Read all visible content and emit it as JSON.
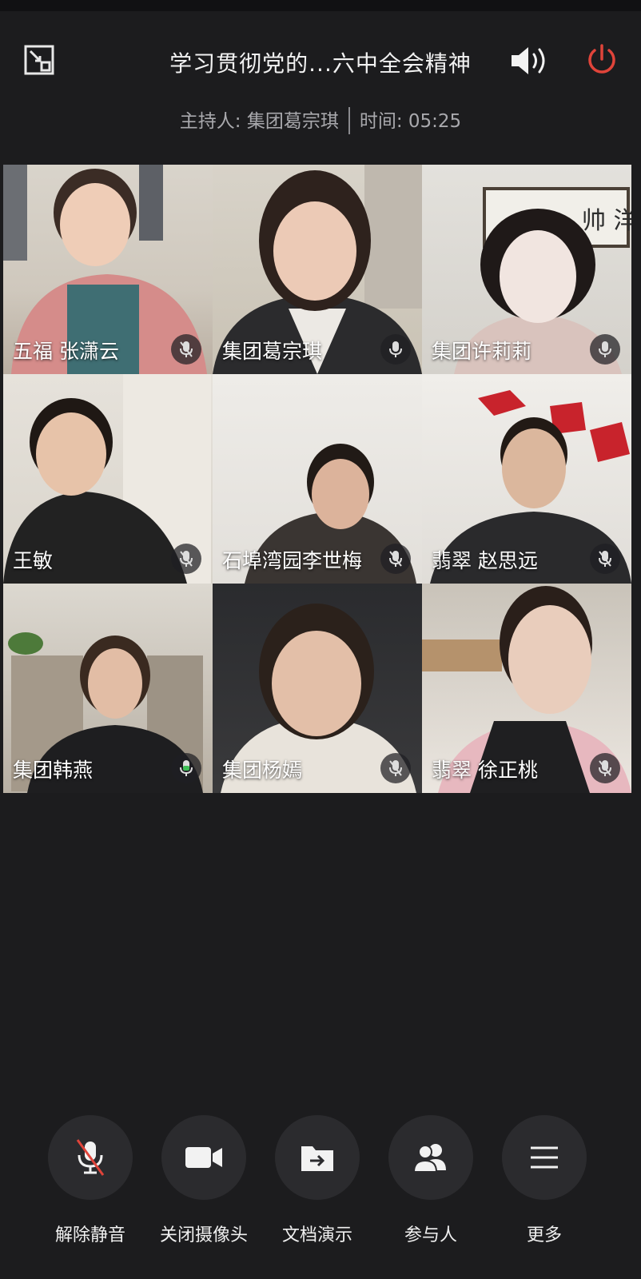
{
  "header": {
    "title": "学习贯彻党的...六中全会精神",
    "host_label": "主持人:",
    "host_name": "集团葛宗琪",
    "time_label": "时间:",
    "time_value": "05:25"
  },
  "participants": [
    {
      "name": "五福 张潇云",
      "muted": true
    },
    {
      "name": "集团葛宗琪",
      "muted": false
    },
    {
      "name": "集团许莉莉",
      "muted": false
    },
    {
      "name": "王敏",
      "muted": true
    },
    {
      "name": "石埠湾园李世梅",
      "muted": true
    },
    {
      "name": "翡翠 赵思远",
      "muted": true
    },
    {
      "name": "集团韩燕",
      "muted": false
    },
    {
      "name": "集团杨嫣",
      "muted": true
    },
    {
      "name": "翡翠 徐正桃",
      "muted": true
    }
  ],
  "controls": [
    {
      "label": "解除静音",
      "icon": "mic-muted-icon"
    },
    {
      "label": "关闭摄像头",
      "icon": "camera-icon"
    },
    {
      "label": "文档演示",
      "icon": "folder-share-icon"
    },
    {
      "label": "参与人",
      "icon": "people-icon"
    },
    {
      "label": "更多",
      "icon": "menu-icon"
    }
  ],
  "colors": {
    "background": "#1c1c1e",
    "power": "#e0443a",
    "control_circle": "#2b2b2e",
    "mic_active": "#3fbf57"
  }
}
